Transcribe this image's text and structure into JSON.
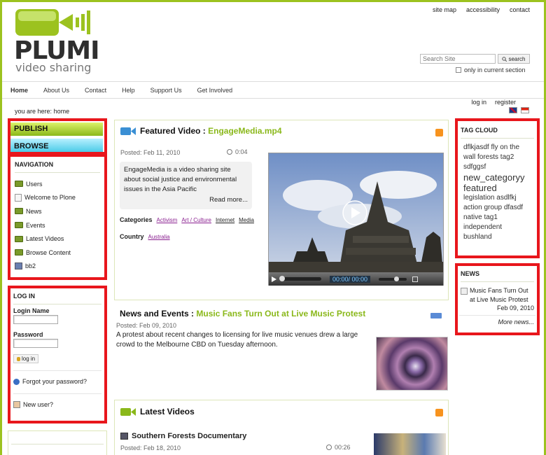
{
  "header": {
    "top_links": [
      "site map",
      "accessibility",
      "contact"
    ],
    "logo_text": "PLUMI",
    "logo_sub": "video sharing",
    "search_placeholder": "Search Site",
    "search_button": "search",
    "only_current": "only in current section"
  },
  "nav": {
    "items": [
      {
        "label": "Home",
        "active": true
      },
      {
        "label": "About Us",
        "active": false
      },
      {
        "label": "Contact",
        "active": false
      },
      {
        "label": "Help",
        "active": false
      },
      {
        "label": "Support Us",
        "active": false
      },
      {
        "label": "Get Involved",
        "active": false
      }
    ]
  },
  "auth": {
    "login": "log in",
    "register": "register"
  },
  "breadcrumb": {
    "prefix": "you are here:",
    "current": "home"
  },
  "left": {
    "publish": "PUBLISH",
    "browse": "BROWSE",
    "navigation_title": "NAVIGATION",
    "navigation_items": [
      {
        "label": "Users",
        "icon": "folder"
      },
      {
        "label": "Welcome to Plone",
        "icon": "document"
      },
      {
        "label": "News",
        "icon": "folder"
      },
      {
        "label": "Events",
        "icon": "folder"
      },
      {
        "label": "Latest Videos",
        "icon": "folder"
      },
      {
        "label": "Browse Content",
        "icon": "folder"
      },
      {
        "label": "bb2",
        "icon": "image"
      }
    ],
    "login_title": "LOG IN",
    "login_name_label": "Login Name",
    "password_label": "Password",
    "login_button": "log in",
    "forgot": "Forgot your password?",
    "new_user": "New user?"
  },
  "featured": {
    "title_prefix": "Featured Video :",
    "title_link": "EngageMedia.mp4",
    "posted": "Posted: Feb 11, 2010",
    "duration": "0:04",
    "description": "EngageMedia is a video sharing site about social justice and environmental issues in the Asia Pacific",
    "read_more": "Read more...",
    "categories_label": "Categories",
    "categories": [
      "Activism",
      "Art / Culture",
      "Internet",
      "Media"
    ],
    "country_label": "Country",
    "country": "Australia",
    "player_time": "00:00/ 00:00"
  },
  "news_events": {
    "title_prefix": "News and Events :",
    "title_link": "Music Fans Turn Out at Live Music Protest",
    "posted": "Posted: Feb 09, 2010",
    "body": "A protest about recent changes to licensing for live music venues drew a large crowd to the Melbourne CBD on Tuesday afternoon."
  },
  "latest_videos": {
    "title": "Latest Videos",
    "item_title": "Southern Forests Documentary",
    "posted": "Posted: Feb 18, 2010",
    "duration": "00:26"
  },
  "tag_cloud": {
    "title": "TAG CLOUD",
    "line1": "dflkjasdf fly on the wall forests tag2 sdfggsf",
    "line2": "new_categoryy featured",
    "line3": "legislation asdlfkj action group dfasdf native tag1 independent bushland"
  },
  "news": {
    "title": "NEWS",
    "item": "Music Fans Turn Out at Live Music Protest",
    "date": "Feb 09, 2010",
    "more": "More news..."
  },
  "colors": {
    "accent": "#8ab81a",
    "highlight_box": "#e8161c",
    "frame": "#9cc21f"
  }
}
